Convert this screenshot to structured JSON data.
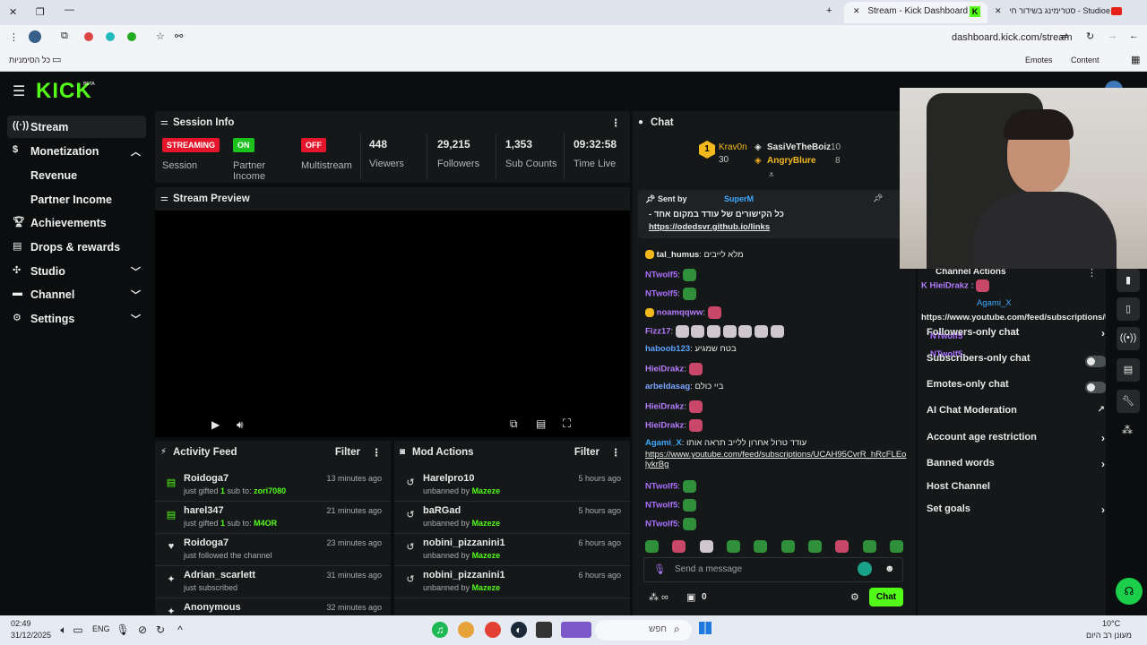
{
  "browser": {
    "tabs": [
      {
        "title": "Stream - Kick Dashboard"
      },
      {
        "title": "סטרימינג בשידור חי - Studio‏e"
      }
    ],
    "url": "dashboard.kick.com/stream",
    "bookmarks": {
      "all": "כל הסימניות",
      "emotes": "Emotes",
      "content": "Content"
    }
  },
  "app": {
    "logo": "KICK",
    "logo_badge": "BETA",
    "sidebar": [
      {
        "label": "Stream",
        "icon": "wifi-icon"
      },
      {
        "label": "Monetization",
        "icon": "dollar-icon"
      },
      {
        "label": "Revenue"
      },
      {
        "label": "Partner Income"
      },
      {
        "label": "Achievements",
        "icon": "trophy-icon"
      },
      {
        "label": "Drops & rewards",
        "icon": "gift-icon"
      },
      {
        "label": "Studio",
        "icon": "studio-icon"
      },
      {
        "label": "Channel",
        "icon": "channel-icon"
      },
      {
        "label": "Settings",
        "icon": "gear-icon"
      }
    ]
  },
  "session": {
    "title": "Session Info",
    "stats": [
      {
        "badge": "STREAMING",
        "label": "Session",
        "color": "#e5162b"
      },
      {
        "badge": "ON",
        "label": "Partner Income",
        "color": "#1cc21c"
      },
      {
        "badge": "OFF",
        "label": "Multistream",
        "color": "#e5162b"
      },
      {
        "value": "448",
        "label": "Viewers"
      },
      {
        "value": "29,215",
        "label": "Followers"
      },
      {
        "value": "1,353",
        "label": "Sub Counts"
      },
      {
        "value": "09:32:58",
        "label": "Time Live"
      }
    ]
  },
  "preview": {
    "title": "Stream Preview"
  },
  "activity": {
    "title": "Activity Feed",
    "filter": "Filter",
    "items": [
      {
        "name": "Roidoga7",
        "pre": "just gifted ",
        "count": "1",
        "mid": " sub to: ",
        "target": "zori7080",
        "time": "13 minutes ago",
        "icon": "gift-icon"
      },
      {
        "name": "harel347",
        "pre": "just gifted ",
        "count": "1",
        "mid": " sub to: ",
        "target": "M4OR",
        "time": "21 minutes ago",
        "icon": "gift-icon"
      },
      {
        "name": "Roidoga7",
        "pre": "just followed the channel",
        "count": "",
        "mid": "",
        "target": "",
        "time": "23 minutes ago",
        "icon": "heart-icon"
      },
      {
        "name": "Adrian_scarlett",
        "pre": "just subscribed",
        "count": "",
        "mid": "",
        "target": "",
        "time": "31 minutes ago",
        "icon": "star-icon"
      },
      {
        "name": "Anonymous",
        "pre": "",
        "count": "",
        "mid": "",
        "target": "",
        "time": "32 minutes ago",
        "icon": "star-icon"
      }
    ]
  },
  "mod": {
    "title": "Mod Actions",
    "filter": "Filter",
    "items": [
      {
        "name": "Harelpro10",
        "action": "unbanned by ",
        "by": "Mazeze",
        "time": "5 hours ago"
      },
      {
        "name": "baRGad",
        "action": "unbanned by ",
        "by": "Mazeze",
        "time": "5 hours ago"
      },
      {
        "name": "nobini_pizzanini1",
        "action": "unbanned by ",
        "by": "Mazeze",
        "time": "6 hours ago"
      },
      {
        "name": "nobini_pizzanini1",
        "action": "unbanned by ",
        "by": "Mazeze",
        "time": "6 hours ago"
      }
    ]
  },
  "chat": {
    "title": "Chat",
    "leaders": [
      {
        "rank": "1",
        "name": "Krav0n",
        "count": "30"
      },
      {
        "name": "SasiVeTheBoiz",
        "count": "10"
      },
      {
        "name": "AngryBlure",
        "count": "8"
      }
    ],
    "pinned": {
      "sent_by": "Sent by",
      "author": "SuperM",
      "text": "- כל הקישורים של עודד במקום אחד",
      "link": "https://odedsvr.github.io/links"
    },
    "messages": [
      {
        "user": "tal_humus",
        "text": "מלא לייבים",
        "color": "#53fc18"
      },
      {
        "user": "NTwolf5",
        "text": "",
        "color": "#a970ff"
      },
      {
        "user": "NTwolf5",
        "text": "",
        "color": "#a970ff"
      },
      {
        "user": "noamqqww",
        "text": "",
        "color": "#b57cff"
      },
      {
        "user": "Fizz17",
        "text": "",
        "color": "#b57cff"
      },
      {
        "user": "haboob123",
        "text": "בטח שמגיע",
        "color": "#5aa2ff"
      },
      {
        "user": "HieiDrakz",
        "text": "",
        "color": "#b57cff"
      },
      {
        "user": "arbeldasag",
        "text": "ביי כולם",
        "color": "#7aa6ff"
      },
      {
        "user": "HieiDrakz",
        "text": "",
        "color": "#b57cff"
      },
      {
        "user": "HieiDrakz",
        "text": "",
        "color": "#b57cff"
      },
      {
        "user": "Agami_X",
        "text": "עודד טרול אחרון ללייב תראה אותו",
        "color": "#3fa9ff"
      },
      {
        "user": "NTwolf5",
        "text": "",
        "color": "#a970ff"
      },
      {
        "user": "NTwolf5",
        "text": "",
        "color": "#a970ff"
      },
      {
        "user": "NTwolf5",
        "text": "",
        "color": "#a970ff"
      }
    ],
    "link_msg": "https://www.youtube.com/feed/subscriptions/UCAH95CvrR_hRcFLEolykrBg",
    "input_placeholder": "Send a message",
    "send": "Chat",
    "points": "0"
  },
  "actions": {
    "title": "Channel Actions",
    "items": [
      {
        "label": "Followers-only chat",
        "type": "chev"
      },
      {
        "label": "Subscribers-only chat",
        "type": "toggle"
      },
      {
        "label": "Emotes-only chat",
        "type": "toggle"
      },
      {
        "label": "AI Chat Moderation",
        "type": "ext"
      },
      {
        "label": "Account age restriction",
        "type": "chev"
      },
      {
        "label": "Banned words",
        "type": "chev"
      },
      {
        "label": "Host Channel",
        "type": "none"
      },
      {
        "label": "Set goals",
        "type": "chev"
      }
    ],
    "overlay": {
      "user1": "HieiDrakz",
      "user2": "Agami_X",
      "text2": "עודד טרול אחרון ללייב תראה אותו",
      "link2": "https://www.youtube.com/feed/subscriptions/UCA",
      "user3": "NTwolf5",
      "user4": "NTwolf5"
    }
  },
  "taskbar": {
    "time": "02:49",
    "date": "31/12/2025",
    "lang": "ENG",
    "search": "חפש",
    "weather": "10°C",
    "weather_desc": "מעונן רב היום"
  }
}
